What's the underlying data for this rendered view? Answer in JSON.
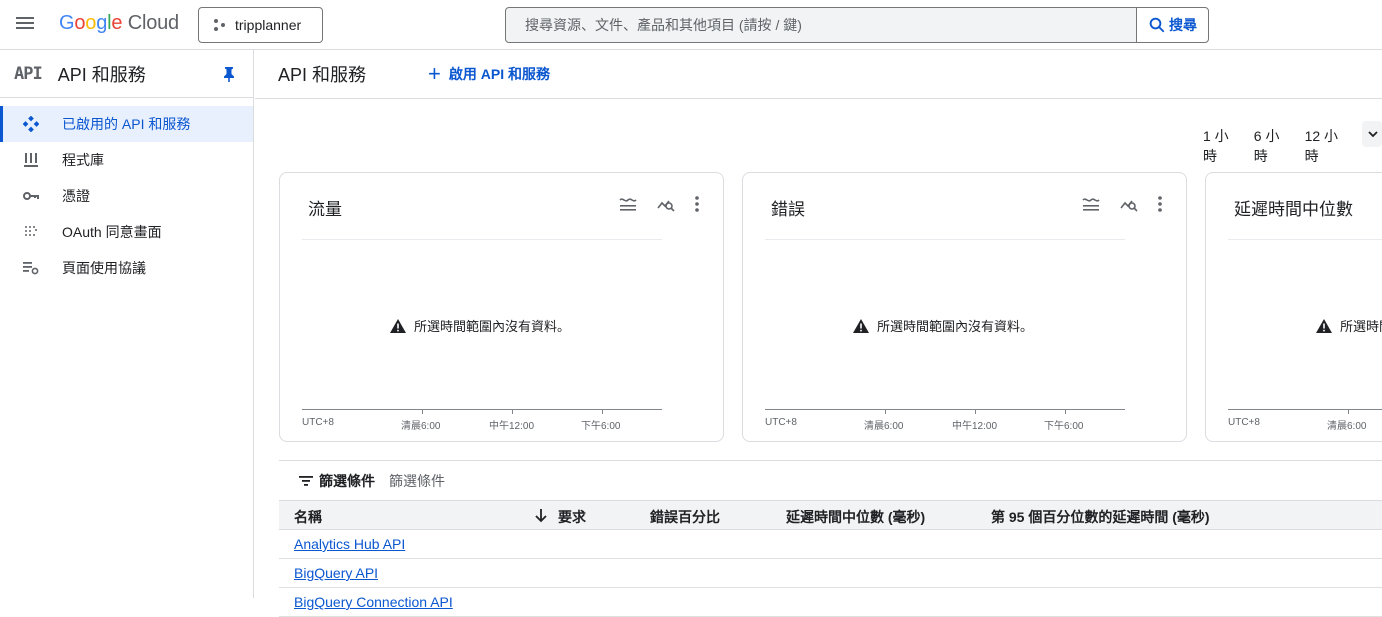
{
  "header": {
    "logo_letters": [
      "G",
      "o",
      "o",
      "g",
      "l",
      "e"
    ],
    "logo_cloud": "Cloud",
    "project_name": "tripplanner",
    "search_placeholder": "搜尋資源、文件、產品和其他項目 (請按 / 鍵)",
    "search_button": "搜尋"
  },
  "sidebar": {
    "logo_text": "API",
    "title": "API 和服務",
    "items": [
      {
        "label": "已啟用的 API 和服務",
        "icon": "api-diamond-icon",
        "active": true
      },
      {
        "label": "程式庫",
        "icon": "library-icon",
        "active": false
      },
      {
        "label": "憑證",
        "icon": "key-icon",
        "active": false
      },
      {
        "label": "OAuth 同意畫面",
        "icon": "oauth-dots-icon",
        "active": false
      },
      {
        "label": "頁面使用協議",
        "icon": "settings-list-icon",
        "active": false
      }
    ]
  },
  "main": {
    "title": "API 和服務",
    "enable_button": "啟用 API 和服務",
    "time_ranges": [
      "1 小時",
      "6 小時",
      "12 小時"
    ],
    "cards": [
      {
        "title": "流量",
        "nodata": "所選時間範圍內沒有資料。",
        "ticks": [
          "UTC+8",
          "清晨6:00",
          "中午12:00",
          "下午6:00"
        ]
      },
      {
        "title": "錯誤",
        "nodata": "所選時間範圍內沒有資料。",
        "ticks": [
          "UTC+8",
          "清晨6:00",
          "中午12:00",
          "下午6:00"
        ]
      },
      {
        "title": "延遲時間中位數",
        "nodata": "所選時間範圍內沒有資料。",
        "ticks": [
          "UTC+8",
          "清晨6:00"
        ]
      }
    ],
    "filter": {
      "label": "篩選條件",
      "placeholder": "篩選條件"
    },
    "table": {
      "columns": [
        "名稱",
        "要求",
        "錯誤百分比",
        "延遲時間中位數 (毫秒)",
        "第 95 個百分位數的延遲時間 (毫秒)"
      ],
      "rows": [
        "Analytics Hub API",
        "BigQuery API",
        "BigQuery Connection API"
      ]
    }
  },
  "colors": {
    "accent": "#0b57d0",
    "active_bg": "#e8f0fe",
    "border": "#dadce0"
  }
}
